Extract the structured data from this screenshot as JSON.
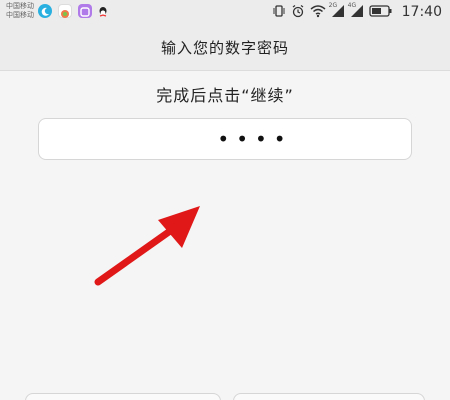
{
  "status_bar": {
    "carrier_line1": "中国移动",
    "carrier_line2": "中国移动",
    "network_2g": "2G",
    "network_4g": "4G",
    "time": "17:40",
    "icons": [
      "vibrate-icon",
      "alarm-icon",
      "wifi-icon",
      "signal-icon",
      "battery-icon"
    ]
  },
  "header": {
    "title": "输入您的数字密码"
  },
  "main": {
    "instruction": "完成后点击“继续”",
    "pin_value": "••••"
  },
  "colors": {
    "arrow": "#e01818",
    "app_blue": "#2ab0e0",
    "app_green": "#f07a4a",
    "app_purple": "#b07ae8"
  }
}
